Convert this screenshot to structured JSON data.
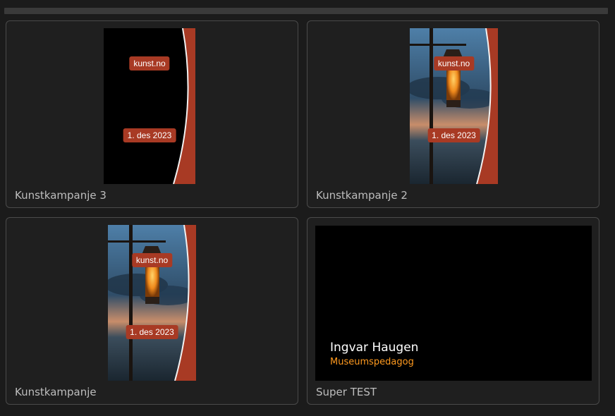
{
  "cards": [
    {
      "label": "Kunstkampanje 3",
      "badge_top": "kunst.no",
      "badge_bottom": "1. des 2023"
    },
    {
      "label": "Kunstkampanje 2",
      "badge_top": "kunst.no",
      "badge_bottom": "1. des 2023"
    },
    {
      "label": "Kunstkampanje",
      "badge_top": "kunst.no",
      "badge_bottom": "1. des 2023"
    },
    {
      "label": "Super TEST",
      "name": "Ingvar Haugen",
      "role": "Museumspedagog"
    }
  ],
  "colors": {
    "badge": "#a83a24",
    "role_text": "#ff9a1f",
    "card_border": "#4a4a4a"
  }
}
